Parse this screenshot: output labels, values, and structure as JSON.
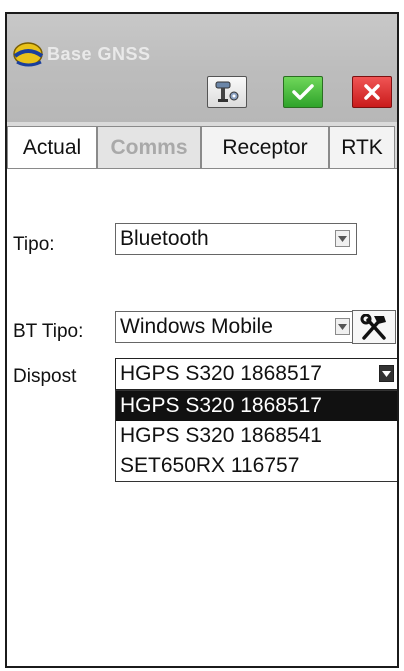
{
  "app": {
    "title": "Base GNSS"
  },
  "toolbar": {
    "settings_icon": "gnss-receiver-settings-icon",
    "ok_icon": "checkmark-icon",
    "cancel_icon": "close-icon",
    "ok_color": "#2fa32a",
    "cancel_color": "#c91b1b"
  },
  "tabs": [
    {
      "label": "Actual",
      "state": "active"
    },
    {
      "label": "Comms",
      "state": "disabled"
    },
    {
      "label": "Receptor",
      "state": "normal"
    },
    {
      "label": "RTK",
      "state": "normal"
    }
  ],
  "form": {
    "tipo": {
      "label": "Tipo:",
      "value": "Bluetooth"
    },
    "bt_tipo": {
      "label": "BT Tipo:",
      "value": "Windows Mobile",
      "tools_icon": "hammer-wrench-icon"
    },
    "dispost": {
      "label": "Dispost",
      "value": "HGPS S320 1868517",
      "options": [
        "HGPS S320 1868517",
        "HGPS S320 1868541",
        "SET650RX 116757"
      ],
      "selected_index": 0
    }
  }
}
